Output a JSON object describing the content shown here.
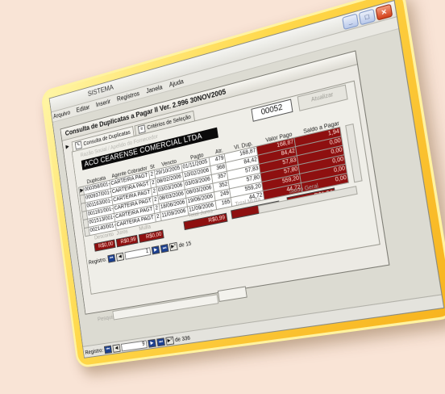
{
  "app": {
    "title": "SISTEMA",
    "menu": [
      "Arquivo",
      "Editar",
      "Inserir",
      "Registros",
      "Janela",
      "Ajuda"
    ]
  },
  "form": {
    "title": "Consulta de Duplicatas a Pagar II  Ver. 2.996 30NOV2005",
    "tabs": [
      "Consulta de Duplicatas",
      "Critérios de Seleção"
    ],
    "razao_label": "Razão Social / Apelido do Fornecedor",
    "razao_value": "ACO CEARENSE COMERCIAL LTDA",
    "code_value": "00052",
    "action_button": "Atualizar",
    "columns": [
      "Duplicata",
      "Agente Cobrador",
      "St",
      "Vencto",
      "Pagto",
      "Atr.",
      "Vl. Dup.",
      "Valor Pago",
      "Saldo a Pagar"
    ],
    "rows": [
      {
        "dup": "000358/001-0",
        "agente": "CARTEIRA PAGT",
        "st": "2",
        "venc": "29/10/2005",
        "pago": "01/11/2005",
        "atr": "479",
        "vl": "168,87",
        "vp": "168,87",
        "sp": "1,94"
      },
      {
        "dup": "000937/001-0",
        "agente": "CARTEIRA PAGT",
        "st": "2",
        "venc": "08/02/2006",
        "pago": "10/02/2006",
        "atr": "368",
        "vl": "84,42",
        "vp": "84,42",
        "sp": "0,00"
      },
      {
        "dup": "001163/001-0",
        "agente": "CARTEIRA PAGT",
        "st": "2",
        "venc": "03/03/2006",
        "pago": "03/03/2006",
        "atr": "357",
        "vl": "57,83",
        "vp": "57,83",
        "sp": "0,00"
      },
      {
        "dup": "001181/001-0",
        "agente": "CARTEIRA PAGT",
        "st": "2",
        "venc": "08/03/2006",
        "pago": "08/03/2006",
        "atr": "352",
        "vl": "57,80",
        "vp": "57,80",
        "sp": "0,00"
      },
      {
        "dup": "001513/001-0",
        "agente": "CARTEIRA PAGT",
        "st": "2",
        "venc": "18/06/2006",
        "pago": "19/06/2006",
        "atr": "249",
        "vl": "559,20",
        "vp": "559,20",
        "sp": "0,00"
      },
      {
        "dup": "002140/001-0",
        "agente": "CARTEIRA PAGT",
        "st": "2",
        "venc": "11/09/2006",
        "pago": "11/09/2006",
        "atr": "165",
        "vl": "44,72",
        "vp": "44,72",
        "sp": "0,00"
      }
    ],
    "totals": {
      "desconto_label": "Desconto",
      "desconto": "R$0,00",
      "juros_label": "Juros",
      "juros": "R$0,99",
      "multa_label": "Multa",
      "multa": "R$0,00",
      "total_juros_label": "Total Juros",
      "total_juros": "R$0,99",
      "total_multa_label": "Total Multa",
      "total_multa": "R$0,00",
      "saldo_geral_label": "Saldo Geral",
      "saldo_geral": "R$1,94"
    },
    "inner_nav": {
      "label": "Registro:",
      "current": "1",
      "of_text": "de 15"
    }
  },
  "search": {
    "label": "Pesquisa"
  },
  "outer_nav": {
    "label": "Registro:",
    "current": "9",
    "of_text": "de 336"
  }
}
